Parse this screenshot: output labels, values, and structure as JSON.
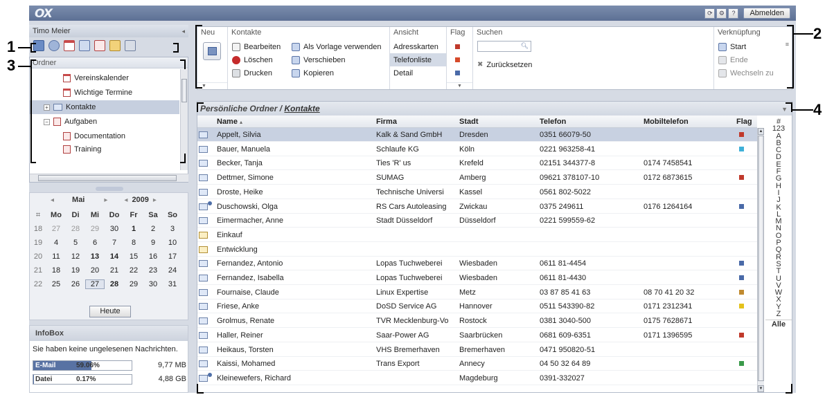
{
  "header": {
    "logo": "OX",
    "logout_label": "Abmelden",
    "icons": [
      "refresh-icon",
      "settings-icon",
      "help-icon"
    ],
    "icon_glyphs": [
      "⟳",
      "⚙",
      "?"
    ]
  },
  "left": {
    "user_name": "Timo Meier",
    "collapse_glyph": "◂",
    "toolbar_icons": [
      "portal-icon",
      "mail-icon",
      "calendar-icon",
      "contacts-icon",
      "tasks-icon",
      "infostore-icon",
      "options-icon"
    ],
    "folder_header": "Ordner",
    "tree": [
      {
        "label": "Vereinskalender",
        "type": "calendar",
        "indent": 2,
        "expander": ""
      },
      {
        "label": "Wichtige Termine",
        "type": "calendar",
        "indent": 2,
        "expander": ""
      },
      {
        "label": "Kontakte",
        "type": "contacts",
        "indent": 1,
        "expander": "+",
        "selected": true
      },
      {
        "label": "Aufgaben",
        "type": "tasks",
        "indent": 1,
        "expander": "−"
      },
      {
        "label": "Documentation",
        "type": "tasks",
        "indent": 2,
        "expander": ""
      },
      {
        "label": "Training",
        "type": "tasks",
        "indent": 2,
        "expander": ""
      }
    ]
  },
  "calendar": {
    "prev_glyph": "◂",
    "next_glyph": "▸",
    "month": "Mai",
    "year": "2009",
    "week_icon": "⌗",
    "day_headers": [
      "Mo",
      "Di",
      "Mi",
      "Do",
      "Fr",
      "Sa",
      "So"
    ],
    "weeks": [
      {
        "wk": "18",
        "days": [
          "27",
          "28",
          "29",
          "30",
          "1",
          "2",
          "3"
        ]
      },
      {
        "wk": "19",
        "days": [
          "4",
          "5",
          "6",
          "7",
          "8",
          "9",
          "10"
        ]
      },
      {
        "wk": "20",
        "days": [
          "11",
          "12",
          "13",
          "14",
          "15",
          "16",
          "17"
        ]
      },
      {
        "wk": "21",
        "days": [
          "18",
          "19",
          "20",
          "21",
          "22",
          "23",
          "24"
        ]
      },
      {
        "wk": "22",
        "days": [
          "25",
          "26",
          "27",
          "28",
          "29",
          "30",
          "31"
        ]
      }
    ],
    "today_label": "Heute"
  },
  "infobox": {
    "title": "InfoBox",
    "message": "Sie haben keine ungelesenen Nachrichten.",
    "quotas": [
      {
        "label": "E-Mail",
        "percent_text": "59.06%",
        "fill_percent": 59.06,
        "size": "9,77 MB"
      },
      {
        "label": "Datei",
        "percent_text": "0.17%",
        "fill_percent": 0.17,
        "size": "4,88 GB"
      }
    ]
  },
  "ribbon": {
    "neu": {
      "title": "Neu"
    },
    "kontakte": {
      "title": "Kontakte",
      "items": [
        "Bearbeiten",
        "Als Vorlage verwenden",
        "Löschen",
        "Verschieben",
        "Drucken",
        "Kopieren"
      ]
    },
    "ansicht": {
      "title": "Ansicht",
      "items": [
        "Adresskarten",
        "Telefonliste",
        "Detail"
      ],
      "selected": "Telefonliste"
    },
    "flag": {
      "title": "Flag"
    },
    "suchen": {
      "title": "Suchen",
      "placeholder": "",
      "reset_label": "Zurücksetzen"
    },
    "verknuepfung": {
      "title": "Verknüpfung",
      "items": [
        "Start",
        "Ende",
        "Wechseln zu"
      ]
    }
  },
  "list": {
    "breadcrumb_root": "Persönliche Ordner",
    "breadcrumb_sep": " / ",
    "breadcrumb_folder": "Kontakte",
    "columns": {
      "name": "Name",
      "firma": "Firma",
      "stadt": "Stadt",
      "telefon": "Telefon",
      "mobil": "Mobiltelefon",
      "flag": "Flag"
    },
    "sort_indicator": "▴",
    "rows": [
      {
        "name": "Appelt, Silvia",
        "firma": "Kalk & Sand GmbH",
        "stadt": "Dresden",
        "telefon": "0351 66079-50",
        "mobil": "",
        "flag": "#c0392b",
        "icon": "contact",
        "selected": true
      },
      {
        "name": "Bauer, Manuela",
        "firma": "Schlaufe KG",
        "stadt": "Köln",
        "telefon": "0221 963258-41",
        "mobil": "",
        "flag": "#3fb0d8",
        "icon": "contact"
      },
      {
        "name": "Becker, Tanja",
        "firma": "Ties 'R' us",
        "stadt": "Krefeld",
        "telefon": "02151 344377-8",
        "mobil": "0174 7458541",
        "flag": "",
        "icon": "contact"
      },
      {
        "name": "Dettmer, Simone",
        "firma": "SUMAG",
        "stadt": "Amberg",
        "telefon": "09621 378107-10",
        "mobil": "0172 6873615",
        "flag": "#c0392b",
        "icon": "contact"
      },
      {
        "name": "Droste, Heike",
        "firma": "Technische Universi",
        "stadt": "Kassel",
        "telefon": "0561 802-5022",
        "mobil": "",
        "flag": "",
        "icon": "contact"
      },
      {
        "name": "Duschowski, Olga",
        "firma": "RS Cars Autoleasing",
        "stadt": "Zwickau",
        "telefon": "0375 249611",
        "mobil": "0176 1264164",
        "flag": "#4a6aa8",
        "icon": "private"
      },
      {
        "name": "Eimermacher, Anne",
        "firma": "Stadt Düsseldorf",
        "stadt": "Düsseldorf",
        "telefon": "0221 599559-62",
        "mobil": "",
        "flag": "",
        "icon": "contact"
      },
      {
        "name": "Einkauf",
        "firma": "",
        "stadt": "",
        "telefon": "",
        "mobil": "",
        "flag": "",
        "icon": "dist"
      },
      {
        "name": "Entwicklung",
        "firma": "",
        "stadt": "",
        "telefon": "",
        "mobil": "",
        "flag": "",
        "icon": "dist"
      },
      {
        "name": "Fernandez, Antonio",
        "firma": "Lopas Tuchweberei",
        "stadt": "Wiesbaden",
        "telefon": "0611 81-4454",
        "mobil": "",
        "flag": "#4a6aa8",
        "icon": "contact"
      },
      {
        "name": "Fernandez, Isabella",
        "firma": "Lopas Tuchweberei",
        "stadt": "Wiesbaden",
        "telefon": "0611 81-4430",
        "mobil": "",
        "flag": "#4a6aa8",
        "icon": "contact"
      },
      {
        "name": "Fournaise, Claude",
        "firma": "Linux Expertise",
        "stadt": "Metz",
        "telefon": "03 87 85 41 63",
        "mobil": "08 70 41 20 32",
        "flag": "#c08a30",
        "icon": "contact"
      },
      {
        "name": "Friese, Anke",
        "firma": "DoSD Service AG",
        "stadt": "Hannover",
        "telefon": "0511 543390-82",
        "mobil": "0171 2312341",
        "flag": "#e4c21c",
        "icon": "contact"
      },
      {
        "name": "Grolmus, Renate",
        "firma": "TVR Mecklenburg-Vo",
        "stadt": "Rostock",
        "telefon": "0381 3040-500",
        "mobil": "0175 7628671",
        "flag": "",
        "icon": "contact"
      },
      {
        "name": "Haller, Reiner",
        "firma": "Saar-Power AG",
        "stadt": "Saarbrücken",
        "telefon": "0681 609-6351",
        "mobil": "0171 1396595",
        "flag": "#c0392b",
        "icon": "contact"
      },
      {
        "name": "Heikaus, Torsten",
        "firma": "VHS Bremerhaven",
        "stadt": "Bremerhaven",
        "telefon": "0471 950820-51",
        "mobil": "",
        "flag": "",
        "icon": "contact"
      },
      {
        "name": "Kaissi, Mohamed",
        "firma": "Trans Export",
        "stadt": "Annecy",
        "telefon": "04 50 32 64 89",
        "mobil": "",
        "flag": "#3a9a4a",
        "icon": "contact"
      },
      {
        "name": "Kleinewefers, Richard",
        "firma": "",
        "stadt": "Magdeburg",
        "telefon": "0391-332027",
        "mobil": "",
        "flag": "",
        "icon": "private"
      }
    ],
    "alphabet": [
      "#",
      "123",
      "A",
      "B",
      "C",
      "D",
      "E",
      "F",
      "G",
      "H",
      "I",
      "J",
      "K",
      "L",
      "M",
      "N",
      "O",
      "P",
      "Q",
      "R",
      "S",
      "T",
      "U",
      "V",
      "W",
      "X",
      "Y",
      "Z"
    ],
    "alle_label": "Alle"
  },
  "callouts": [
    "1",
    "2",
    "3",
    "4"
  ]
}
